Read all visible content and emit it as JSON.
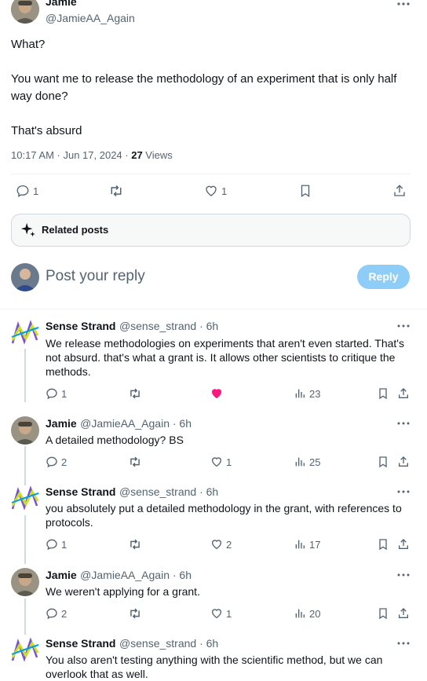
{
  "main_post": {
    "author_name": "Jamie",
    "author_handle": "@JamieAA_Again",
    "text_lines": [
      "What?",
      "You want me to release the methodology of an experiment that is only half way done?",
      "That's absurd"
    ],
    "timestamp": "10:17 AM · Jun 17, 2024 · ",
    "views_count": "27",
    "views_label": " Views",
    "actions": {
      "replies": "1",
      "likes": "1"
    }
  },
  "related_posts_label": "Related posts",
  "composer": {
    "placeholder": "Post your reply",
    "reply_button": "Reply"
  },
  "replies": [
    {
      "name": "Sense Strand",
      "handle": "@sense_strand · 6h",
      "text": "We release methodologies on experiments that aren't even started. That's not absurd. that's what a grant is. It allows other scientists to critique the methods.",
      "replies": "1",
      "likes": "",
      "views": "23",
      "liked": true
    },
    {
      "name": "Jamie",
      "handle": "@JamieAA_Again · 6h",
      "text": "A detailed methodology? BS",
      "replies": "2",
      "likes": "1",
      "views": "25",
      "liked": false
    },
    {
      "name": "Sense Strand",
      "handle": "@sense_strand · 6h",
      "text": "you absolutely put a detailed methodology in the grant, with references to protocols.",
      "replies": "1",
      "likes": "2",
      "views": "17",
      "liked": false
    },
    {
      "name": "Jamie",
      "handle": "@JamieAA_Again · 6h",
      "text": "We weren't applying for a grant.",
      "replies": "2",
      "likes": "1",
      "views": "20",
      "liked": false
    },
    {
      "name": "Sense Strand",
      "handle": "@sense_strand · 6h",
      "text": "You also aren't testing anything with the scientific method, but we can overlook that as well.",
      "replies": "",
      "likes": "",
      "views": "",
      "liked": false
    }
  ],
  "colors": {
    "accent": "#1d9bf0",
    "accent_disabled": "#8ecdf8",
    "like": "#f91880",
    "muted": "#536471"
  },
  "icons": [
    "more-icon",
    "reply-icon",
    "repost-icon",
    "like-icon",
    "bookmark-icon",
    "share-icon",
    "views-icon",
    "sparkle-icon"
  ]
}
